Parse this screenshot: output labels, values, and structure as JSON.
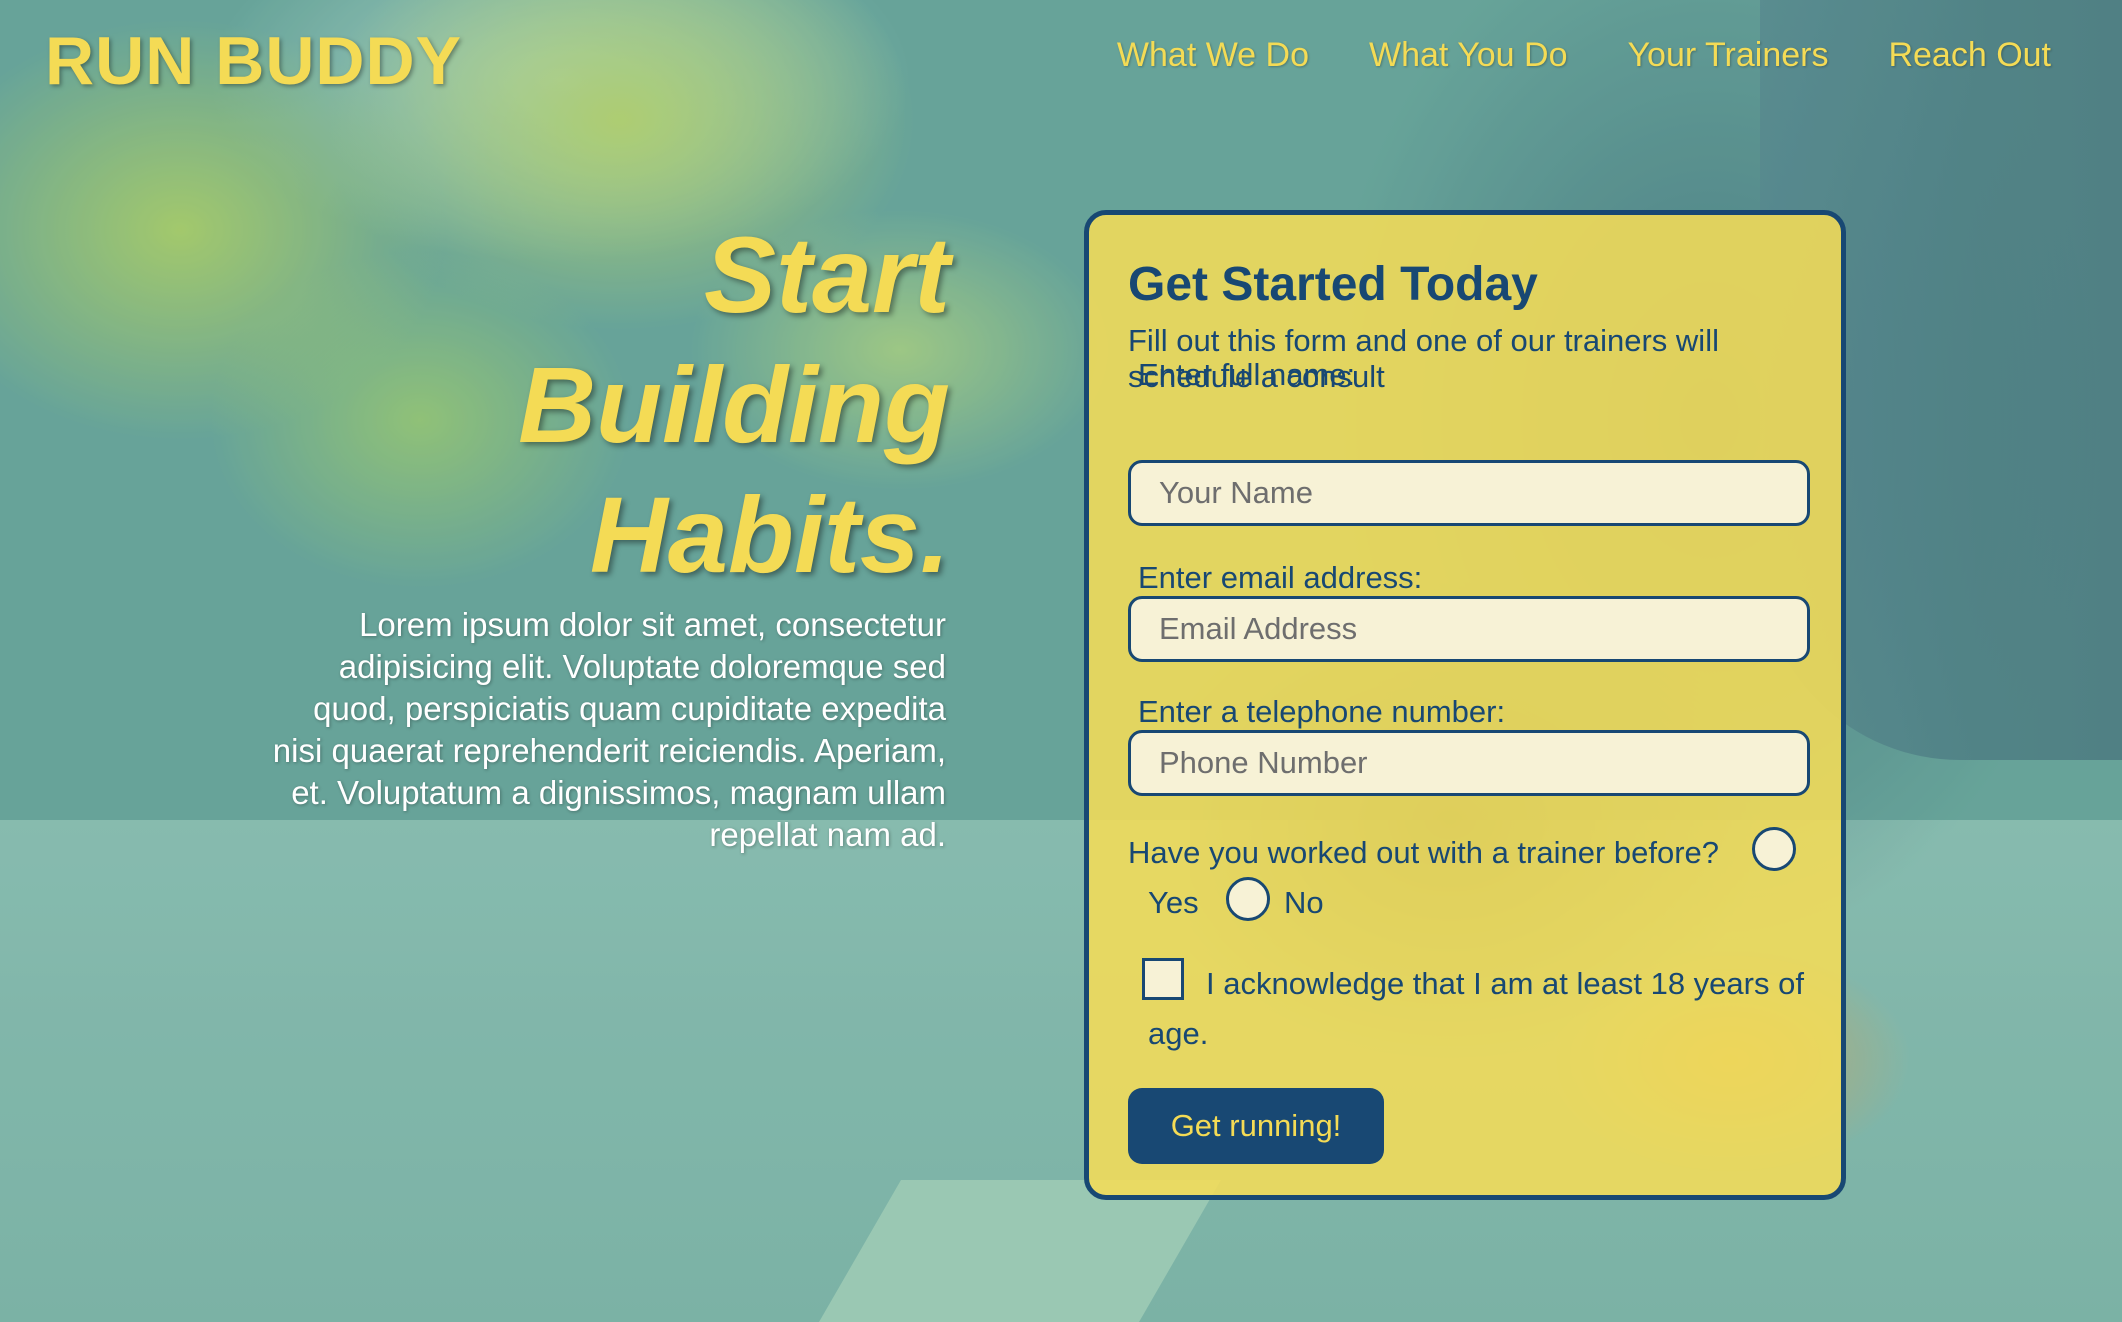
{
  "brand": {
    "logo": "RUN BUDDY"
  },
  "nav": {
    "items": [
      "What We Do",
      "What You Do",
      "Your Trainers",
      "Reach Out"
    ]
  },
  "hero": {
    "title_lines": [
      "Start",
      "Building",
      "Habits."
    ],
    "text": "Lorem ipsum dolor sit amet, consectetur adipisicing elit. Voluptate doloremque sed quod, perspiciatis quam cupiditate expedita nisi quaerat reprehenderit reiciendis. Aperiam, et. Voluptatum a dignissimos, magnam ullam repellat nam ad."
  },
  "form": {
    "title": "Get Started Today",
    "subtitle": "Fill out this form and one of our trainers will schedule a consult",
    "name_label": "Enter full name:",
    "name_placeholder": "Your Name",
    "email_label": "Enter email address:",
    "email_placeholder": "Email Address",
    "phone_label": "Enter a telephone number:",
    "phone_placeholder": "Phone Number",
    "trainer_question": "Have you worked out with a trainer before?",
    "yes_label": "Yes",
    "no_label": "No",
    "acknowledge_text": "I acknowledge that I am at least 18 years of age.",
    "submit_label": "Get running!"
  },
  "colors": {
    "accent_yellow": "#f4db55",
    "navy": "#184873",
    "input_bg": "#f7f2d6"
  }
}
